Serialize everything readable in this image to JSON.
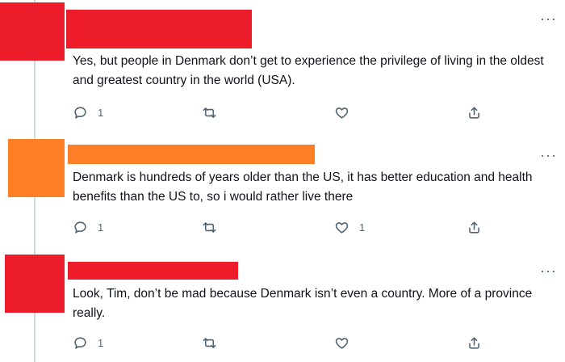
{
  "tweets": [
    {
      "avatar_color": "#ec1c2a",
      "name_color": "#ec1c2a",
      "text": "Yes, but people in Denmark don’t get to experience the privilege of living in the oldest and greatest country in the world (USA).",
      "replies": "1",
      "retweets": "",
      "likes": ""
    },
    {
      "avatar_color": "#ff7f27",
      "name_color": "#ff7f27",
      "text": "Denmark is hundreds of years older than the US, it has better education and health benefits than the US to, so i would rather live there",
      "replies": "1",
      "retweets": "",
      "likes": "1"
    },
    {
      "avatar_color": "#ec1c2a",
      "name_color": "#ec1c2a",
      "text": "Look, Tim, don’t be mad because Denmark isn’t even a country. More of a province really.",
      "replies": "1",
      "retweets": "",
      "likes": ""
    }
  ],
  "icons": {
    "more": "more-horizontal-icon",
    "reply": "reply-bubble-icon",
    "retweet": "retweet-icon",
    "like": "heart-icon",
    "share": "share-icon"
  },
  "colors": {
    "icon_gray": "#536471",
    "thread_line": "#cfd9de"
  }
}
